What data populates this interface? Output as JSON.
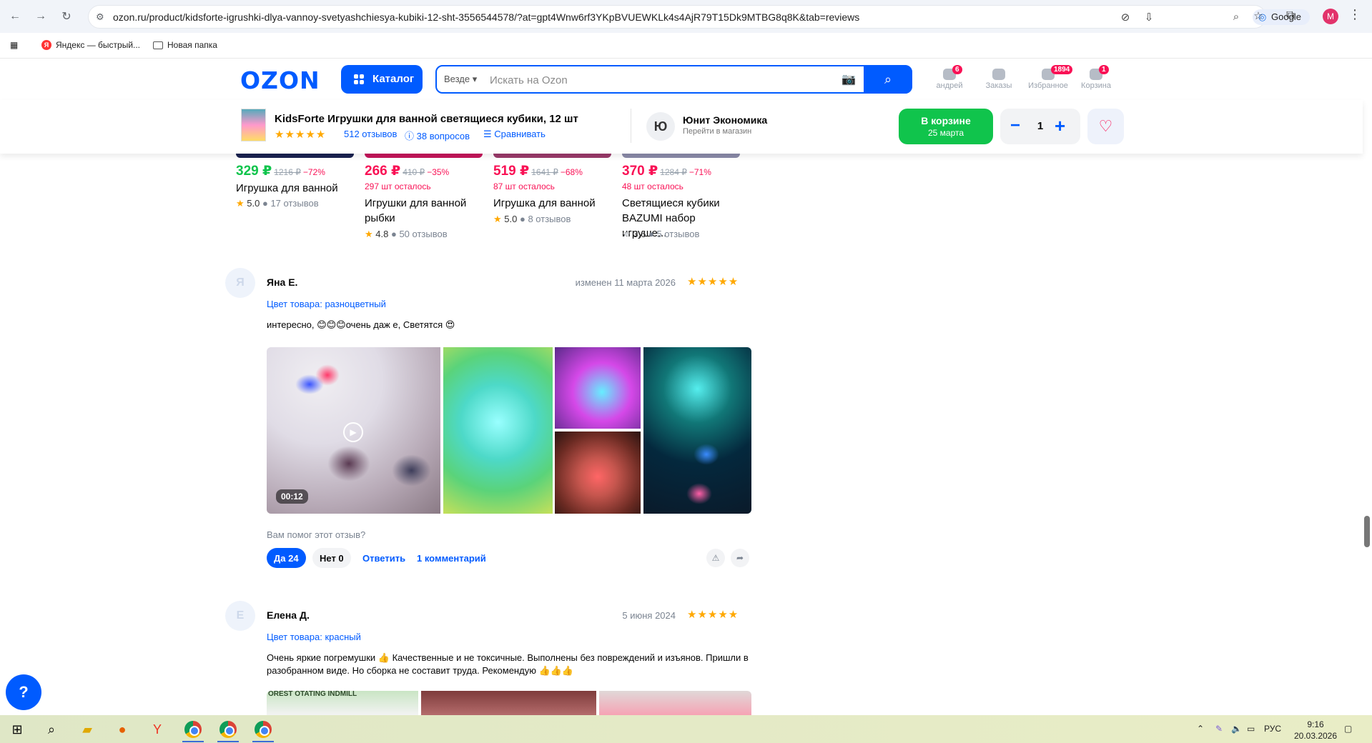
{
  "browser": {
    "url": "ozon.ru/product/kidsforte-igrushki-dlya-vannoy-svetyashchiesya-kubiki-12-sht-3556544578/?at=gpt4Wnw6rf3YKpBVUEWKLk4s4AjR79T15Dk9MTBG8q8K&tab=reviews",
    "search_engine_chip": "Google",
    "profile_initial": "M",
    "bookmarks": [
      {
        "label": "Яндекс — быстрый..."
      },
      {
        "label": "Новая папка"
      }
    ]
  },
  "header": {
    "logo": "OZON",
    "catalog_label": "Каталог",
    "search_scope": "Везде",
    "search_placeholder": "Искать на Ozon",
    "items": [
      {
        "label": "андрей",
        "badge": "6"
      },
      {
        "label": "Заказы",
        "badge": ""
      },
      {
        "label": "Избранное",
        "badge": "1894"
      },
      {
        "label": "Корзина",
        "badge": "1"
      }
    ]
  },
  "product_bar": {
    "title": "KidsForte Игрушки для ванной светящиеся кубики, 12 шт",
    "stars": "★★★★★",
    "reviews_link": "512 отзывов",
    "questions_link": "38 вопросов",
    "compare_link": "Сравнивать",
    "seller_initial": "Ю",
    "seller_name": "Юнит Экономика",
    "seller_sub": "Перейти в магазин",
    "cart_line1": "В корзине",
    "cart_line2": "25 марта",
    "quantity": "1"
  },
  "recommendations": [
    {
      "price": "329 ₽",
      "old_price": "1216 ₽",
      "discount": "−72%",
      "stock": "",
      "title": "Игрушка для ванной",
      "rating": "5.0",
      "reviews": "17 отзывов",
      "price_color": "#10c44c",
      "star_grey": false
    },
    {
      "price": "266 ₽",
      "old_price": "410 ₽",
      "discount": "−35%",
      "stock": "297 шт осталось",
      "title": "Игрушки для ванной рыбки",
      "rating": "4.8",
      "reviews": "50 отзывов",
      "price_color": "#f91155",
      "star_grey": false
    },
    {
      "price": "519 ₽",
      "old_price": "1641 ₽",
      "discount": "−68%",
      "stock": "87 шт осталось",
      "title": "Игрушка для ванной",
      "rating": "5.0",
      "reviews": "8 отзывов",
      "price_color": "#f91155",
      "star_grey": false
    },
    {
      "price": "370 ₽",
      "old_price": "1284 ₽",
      "discount": "−71%",
      "stock": "48 шт осталось",
      "title": "Светящиеся кубики BAZUMI набор игруше...",
      "rating": "3.6",
      "reviews": "5 отзывов",
      "price_color": "#f91155",
      "star_grey": true
    }
  ],
  "reviews": [
    {
      "avatar": "Я",
      "author": "Яна Е.",
      "date": "изменен 11 марта 2026",
      "stars": "★★★★★",
      "variant": "Цвет товара: разноцветный",
      "text": "интересно, 😊😊😊очень даж е, Светятся 😍",
      "video_duration": "00:12",
      "helpful_question": "Вам помог этот отзыв?",
      "yes": "Да 24",
      "no": "Нет 0",
      "reply": "Ответить",
      "comments": "1 комментарий"
    },
    {
      "avatar": "Е",
      "author": "Елена Д.",
      "date": "5 июня 2024",
      "stars": "★★★★★",
      "variant": "Цвет товара: красный",
      "text": "Очень яркие погремушки 👍 Качественные и не токсичные. Выполнены без повреждений и изъянов. Пришли в разобранном виде. Но сборка не составит труда. Рекомендую 👍👍👍",
      "photo_text": "OREST OTATING INDMILL"
    }
  ],
  "taskbar": {
    "lang": "РУС",
    "time": "9:16",
    "date": "20.03.2026"
  },
  "colors": {
    "brand": "#005bff",
    "sale": "#f91155",
    "green": "#10c44c",
    "star": "#ffa800"
  }
}
